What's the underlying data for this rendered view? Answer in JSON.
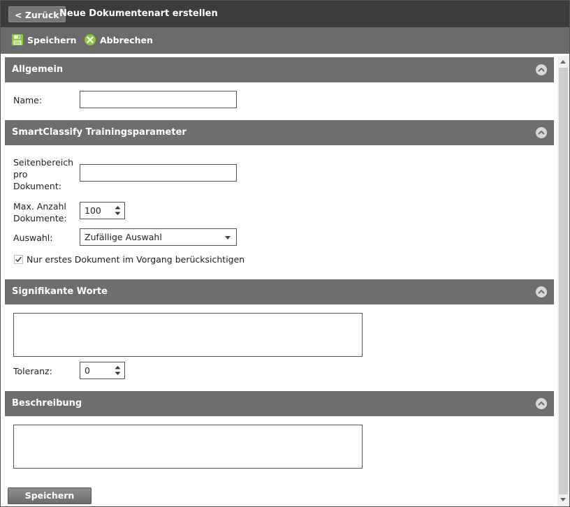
{
  "titlebar": {
    "back_label": "< Zurück",
    "title": "Neue Dokumentenart erstellen"
  },
  "toolbar": {
    "save_label": "Speichern",
    "cancel_label": "Abbrechen"
  },
  "sections": {
    "allgemein": {
      "title": "Allgemein",
      "name_label": "Name:",
      "name_value": ""
    },
    "training": {
      "title": "SmartClassify Trainingsparameter",
      "seitenbereich_label_1": "Seitenbereich",
      "seitenbereich_label_2": "pro",
      "seitenbereich_label_3": "Dokument:",
      "seitenbereich_value": "",
      "max_label_1": "Max. Anzahl",
      "max_label_2": "Dokumente:",
      "max_value": "100",
      "auswahl_label": "Auswahl:",
      "auswahl_value": "Zufällige Auswahl",
      "checkbox_label": "Nur erstes Dokument im Vorgang berücksichtigen",
      "checkbox_checked": true
    },
    "signifikant": {
      "title": "Signifikante Worte",
      "toleranz_label": "Toleranz:",
      "toleranz_value": "0"
    },
    "beschreibung": {
      "title": "Beschreibung"
    }
  },
  "footer": {
    "save_label": "Speichern"
  },
  "colors": {
    "titlebar": "#3c3c3c",
    "toolbar": "#6b6b6b",
    "section_header": "#6e6e6e",
    "save_icon": "#8dc63f",
    "cancel_icon": "#8dc63f"
  }
}
